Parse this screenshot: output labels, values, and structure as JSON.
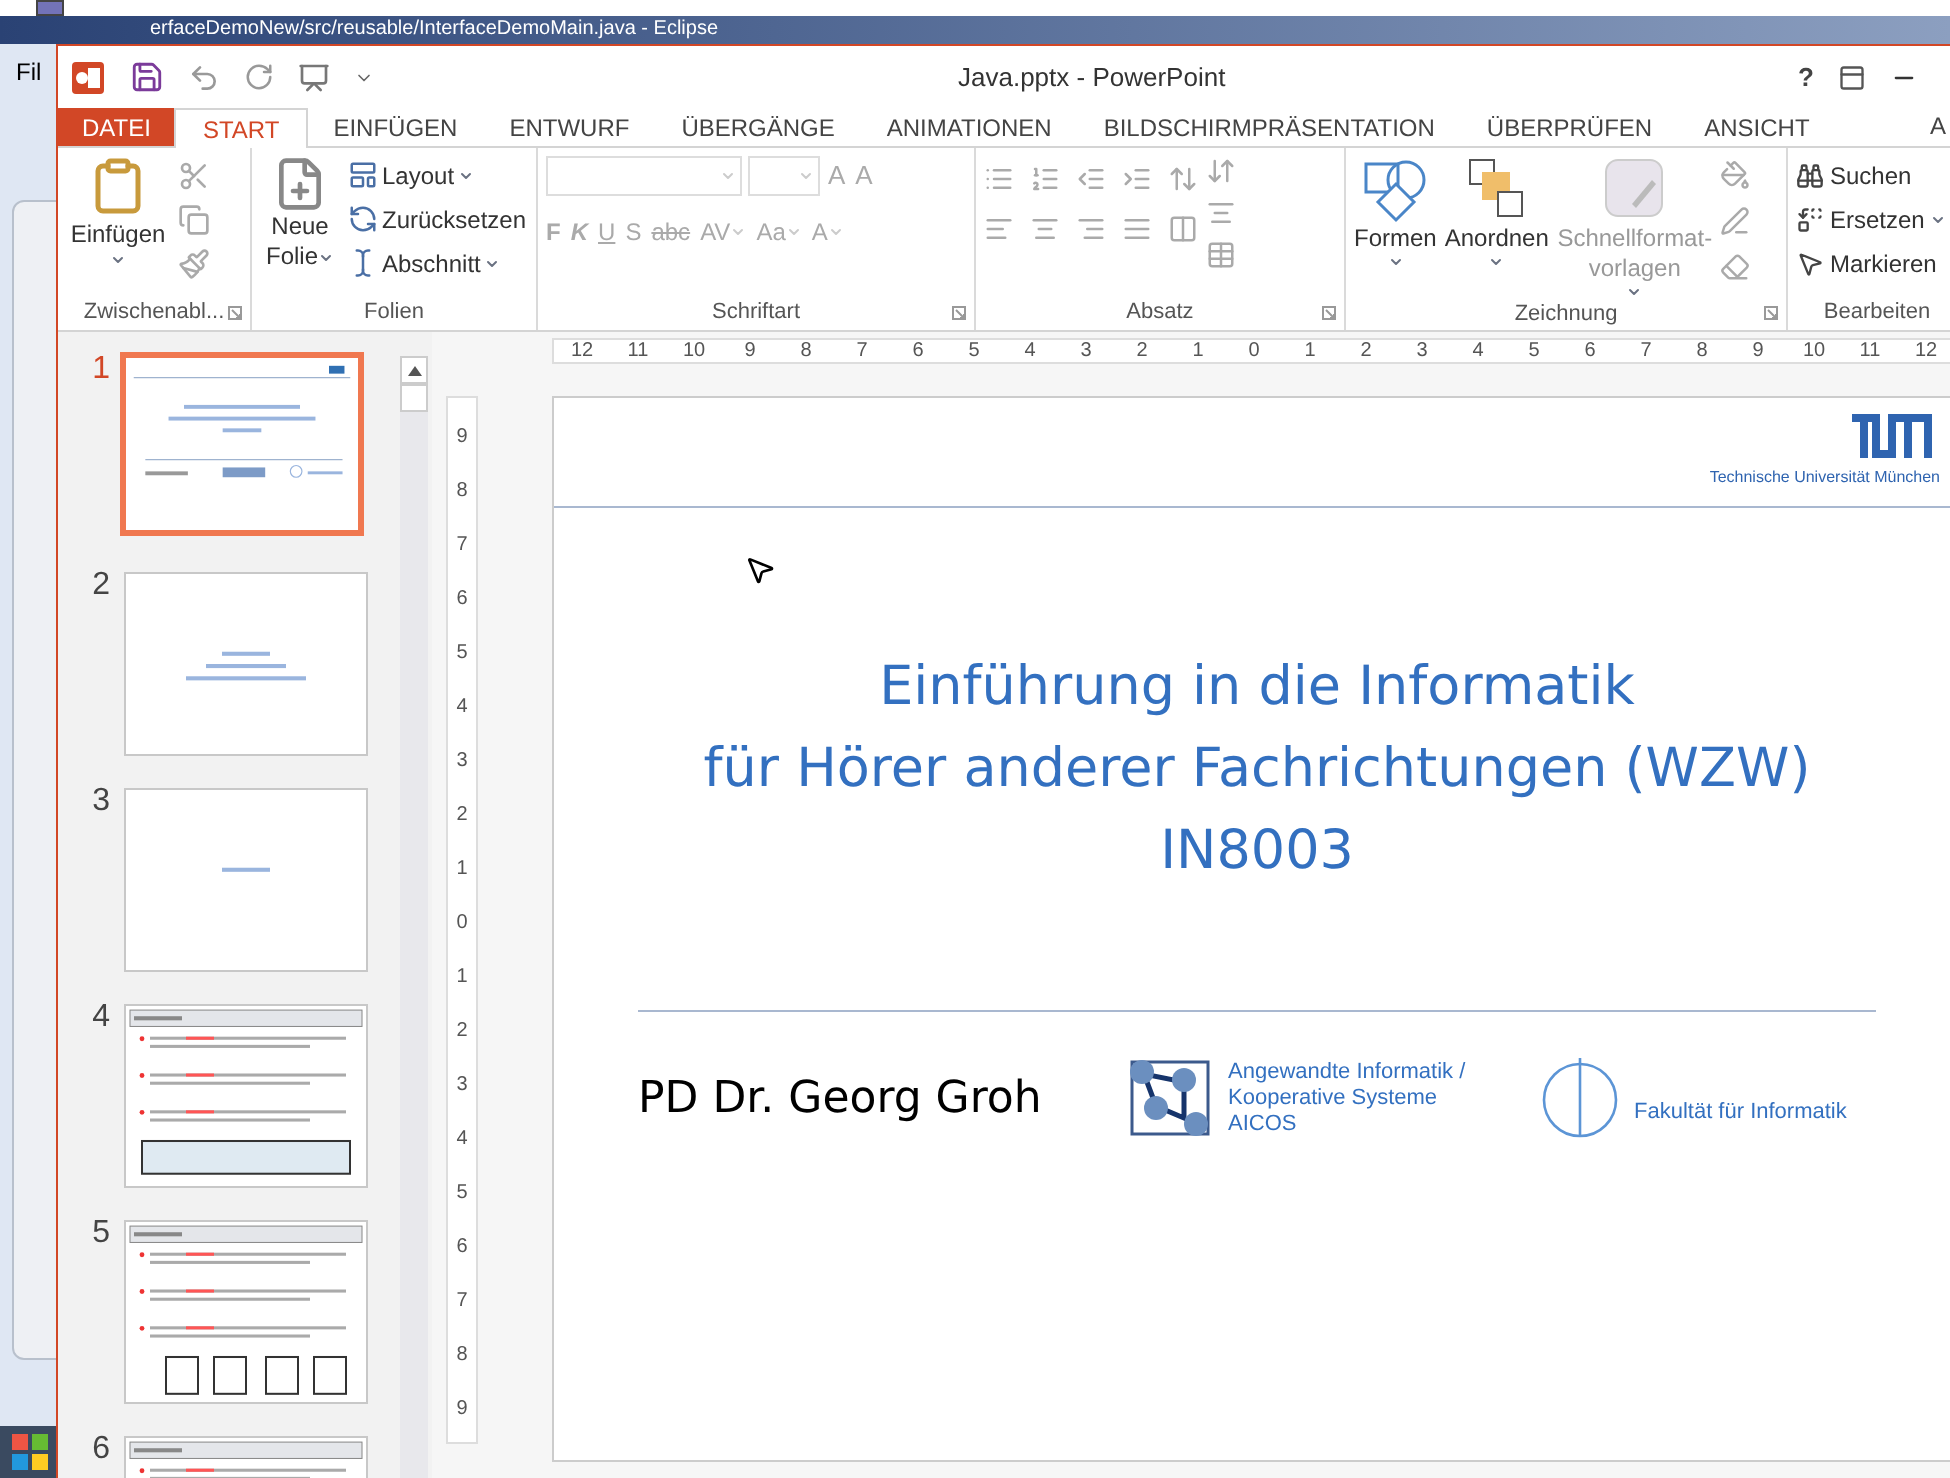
{
  "background_window": {
    "title": "erfaceDemoNew/src/reusable/InterfaceDemoMain.java - Eclipse",
    "menu": "Fil"
  },
  "window": {
    "title": "Java.pptx - PowerPoint",
    "help": "?"
  },
  "tabs": [
    {
      "label": "DATEI",
      "kind": "file",
      "selected": false
    },
    {
      "label": "START",
      "kind": "tab",
      "selected": true
    },
    {
      "label": "EINFÜGEN",
      "kind": "tab",
      "selected": false
    },
    {
      "label": "ENTWURF",
      "kind": "tab",
      "selected": false
    },
    {
      "label": "ÜBERGÄNGE",
      "kind": "tab",
      "selected": false
    },
    {
      "label": "ANIMATIONEN",
      "kind": "tab",
      "selected": false
    },
    {
      "label": "BILDSCHIRMPRÄSENTATION",
      "kind": "tab",
      "selected": false
    },
    {
      "label": "ÜBERPRÜFEN",
      "kind": "tab",
      "selected": false
    },
    {
      "label": "ANSICHT",
      "kind": "tab",
      "selected": false
    }
  ],
  "account": "A",
  "ribbon": {
    "clipboard": {
      "label": "Zwischenabl...",
      "launcher": true,
      "paste": "Einfügen"
    },
    "slides": {
      "label": "Folien",
      "new_slide": "Neue Folie",
      "items": [
        {
          "label": "Layout",
          "dropdown": true
        },
        {
          "label": "Zurücksetzen",
          "dropdown": false
        },
        {
          "label": "Abschnitt",
          "dropdown": true
        }
      ]
    },
    "font": {
      "label": "Schriftart",
      "launcher": true,
      "disabled": true,
      "size_buttons": [
        "A",
        "A"
      ],
      "formats": [
        {
          "label": "F",
          "dropdown": false
        },
        {
          "label": "K",
          "dropdown": false
        },
        {
          "label": "U",
          "dropdown": false
        },
        {
          "label": "S",
          "dropdown": false
        },
        {
          "label": "abc",
          "dropdown": false
        },
        {
          "label": "AV",
          "dropdown": true
        },
        {
          "label": "Aa",
          "dropdown": true
        },
        {
          "label": "A",
          "dropdown": true
        }
      ]
    },
    "paragraph": {
      "label": "Absatz",
      "launcher": true
    },
    "drawing": {
      "label": "Zeichnung",
      "launcher": true,
      "buttons": [
        {
          "label": "Formen",
          "disabled": false
        },
        {
          "label": "Anordnen",
          "disabled": false
        },
        {
          "label": "Schnellformat-vorlagen",
          "disabled": true
        }
      ]
    },
    "editing": {
      "label": "Bearbeiten",
      "items": [
        {
          "label": "Suchen",
          "dropdown": false
        },
        {
          "label": "Ersetzen",
          "dropdown": true
        },
        {
          "label": "Markieren",
          "dropdown": false
        }
      ]
    }
  },
  "slides": [
    {
      "number": "1",
      "selected": true,
      "kind": "title"
    },
    {
      "number": "2",
      "selected": false,
      "kind": "section"
    },
    {
      "number": "3",
      "selected": false,
      "kind": "section"
    },
    {
      "number": "4",
      "selected": false,
      "kind": "bullets"
    },
    {
      "number": "5",
      "selected": false,
      "kind": "diagram"
    },
    {
      "number": "6",
      "selected": false,
      "kind": "bullets"
    }
  ],
  "horizontal_ruler": [
    "12",
    "11",
    "10",
    "9",
    "8",
    "7",
    "6",
    "5",
    "4",
    "3",
    "2",
    "1",
    "0",
    "1",
    "2",
    "3",
    "4",
    "5",
    "6",
    "7",
    "8",
    "9",
    "10",
    "11",
    "12"
  ],
  "vertical_ruler": [
    "9",
    "8",
    "7",
    "6",
    "5",
    "4",
    "3",
    "2",
    "1",
    "0",
    "1",
    "2",
    "3",
    "4",
    "5",
    "6",
    "7",
    "8",
    "9"
  ],
  "slide": {
    "institution": "Technische Universität München",
    "title_lines": [
      "Einführung in die Informatik",
      "für Hörer anderer Fachrichtungen (WZW)",
      "IN8003"
    ],
    "author": "PD Dr. Georg Groh",
    "chair": [
      "Angewandte Informatik /",
      "Kooperative Systeme",
      "AICOS"
    ],
    "faculty": "Fakultät für Informatik"
  }
}
